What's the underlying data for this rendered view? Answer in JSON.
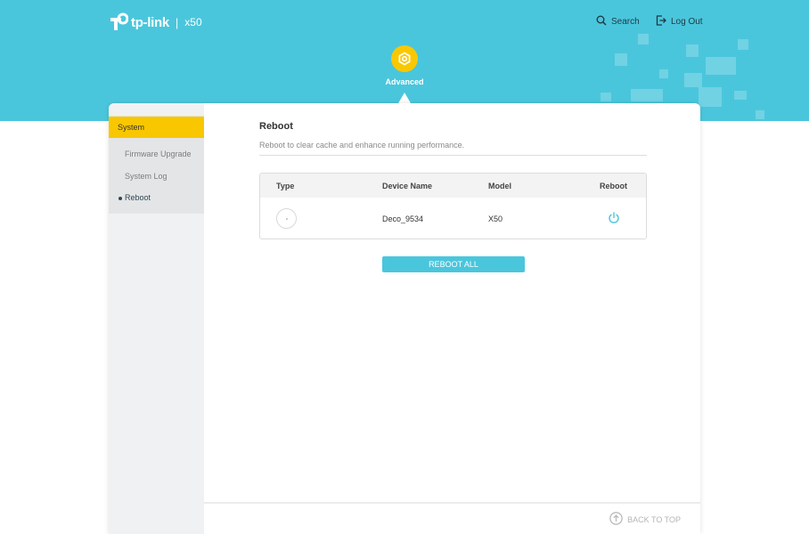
{
  "header": {
    "brand": "tp-link",
    "separator": "|",
    "model": "x50",
    "search_label": "Search",
    "logout_label": "Log Out",
    "active_section": "Advanced"
  },
  "sidebar": {
    "category": "System",
    "items": [
      {
        "label": "Firmware Upgrade",
        "active": false
      },
      {
        "label": "System Log",
        "active": false
      },
      {
        "label": "Reboot",
        "active": true
      }
    ]
  },
  "main": {
    "title": "Reboot",
    "description": "Reboot to clear cache and enhance running performance.",
    "table": {
      "columns": [
        "Type",
        "Device Name",
        "Model",
        "Reboot"
      ],
      "rows": [
        {
          "device_name": "Deco_9534",
          "model": "X50",
          "type_icon": "deco-device-icon",
          "reboot_icon": "power-icon"
        }
      ]
    },
    "reboot_all_label": "REBOOT ALL"
  },
  "footer": {
    "back_to_top_label": "BACK TO TOP"
  },
  "colors": {
    "header_bg": "#4ac6dc",
    "accent_yellow": "#f8c700",
    "button": "#4ac6dc"
  }
}
